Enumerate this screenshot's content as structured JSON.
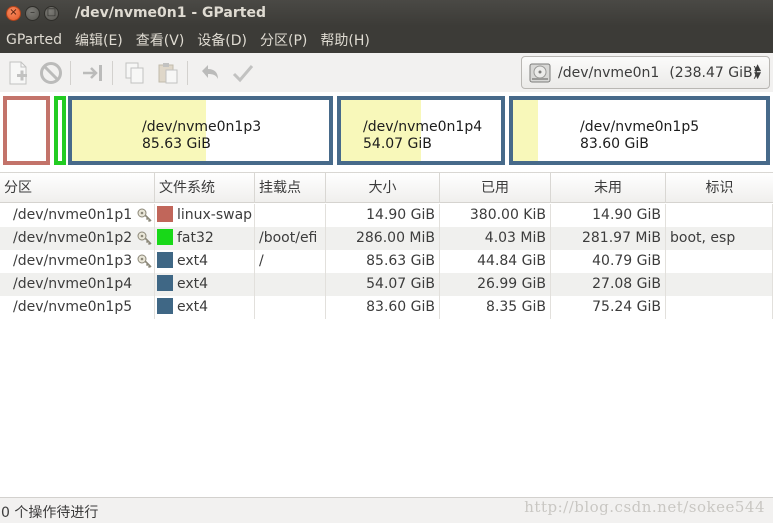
{
  "window": {
    "title": "/dev/nvme0n1 - GParted",
    "close_glyph": "×",
    "minimize_glyph": "–",
    "maximize_glyph": "□"
  },
  "menu": {
    "items": [
      "GParted",
      "编辑(E)",
      "查看(V)",
      "设备(D)",
      "分区(P)",
      "帮助(H)"
    ]
  },
  "toolbar": {
    "icons": [
      "new-partition-icon",
      "delete-icon",
      "resize-move-icon",
      "copy-icon",
      "paste-icon",
      "undo-icon",
      "apply-icon"
    ],
    "device": {
      "name": "/dev/nvme0n1",
      "size": "(238.47 GiB)"
    }
  },
  "graph": {
    "segments": [
      {
        "kind": "swap",
        "name": "",
        "size": ""
      },
      {
        "kind": "efi",
        "name": "",
        "size": ""
      },
      {
        "kind": "ext4",
        "name": "/dev/nvme0n1p3",
        "size": "85.63 GiB",
        "used_fraction": 0.52
      },
      {
        "kind": "ext4",
        "name": "/dev/nvme0n1p4",
        "size": "54.07 GiB",
        "used_fraction": 0.5
      },
      {
        "kind": "ext4",
        "name": "/dev/nvme0n1p5",
        "size": "83.60 GiB",
        "used_fraction": 0.1
      }
    ]
  },
  "table": {
    "headers": [
      "分区",
      "文件系统",
      "挂载点",
      "大小",
      "已用",
      "未用",
      "标识"
    ],
    "rows": [
      {
        "partition": "/dev/nvme0n1p1",
        "locked": true,
        "fs": "linux-swap",
        "fs_color": "#c1665a",
        "mount": "",
        "size": "14.90 GiB",
        "used": "380.00 KiB",
        "unused": "14.90 GiB",
        "flags": ""
      },
      {
        "partition": "/dev/nvme0n1p2",
        "locked": true,
        "fs": "fat32",
        "fs_color": "#18d818",
        "mount": "/boot/efi",
        "size": "286.00 MiB",
        "used": "4.03 MiB",
        "unused": "281.97 MiB",
        "flags": "boot, esp"
      },
      {
        "partition": "/dev/nvme0n1p3",
        "locked": true,
        "fs": "ext4",
        "fs_color": "#3f6785",
        "mount": "/",
        "size": "85.63 GiB",
        "used": "44.84 GiB",
        "unused": "40.79 GiB",
        "flags": ""
      },
      {
        "partition": "/dev/nvme0n1p4",
        "locked": false,
        "fs": "ext4",
        "fs_color": "#3f6785",
        "mount": "",
        "size": "54.07 GiB",
        "used": "26.99 GiB",
        "unused": "27.08 GiB",
        "flags": ""
      },
      {
        "partition": "/dev/nvme0n1p5",
        "locked": false,
        "fs": "ext4",
        "fs_color": "#3f6785",
        "mount": "",
        "size": "83.60 GiB",
        "used": "8.35 GiB",
        "unused": "75.24 GiB",
        "flags": ""
      }
    ]
  },
  "status": {
    "text": "0 个操作待进行",
    "watermark": "http://blog.csdn.net/sokee544"
  }
}
